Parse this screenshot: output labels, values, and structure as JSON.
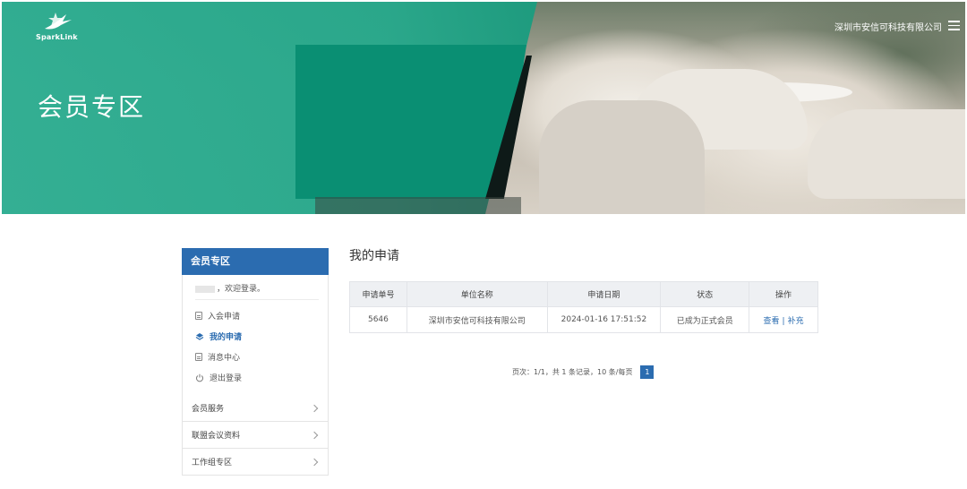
{
  "header": {
    "logo_text": "SparkLink",
    "banner_title": "会员专区",
    "company_name": "深圳市安信可科技有限公司"
  },
  "sidebar": {
    "title": "会员专区",
    "welcome": "，欢迎登录。",
    "user_menu": [
      {
        "label": "入会申请",
        "icon": "document-icon"
      },
      {
        "label": "我的申请",
        "icon": "layers-icon",
        "active": true
      },
      {
        "label": "消息中心",
        "icon": "document-icon"
      },
      {
        "label": "退出登录",
        "icon": "power-icon"
      }
    ],
    "groups": [
      {
        "label": "会员服务"
      },
      {
        "label": "联盟会议资料"
      },
      {
        "label": "工作组专区"
      }
    ]
  },
  "main": {
    "title": "我的申请",
    "table": {
      "headers": [
        "申请单号",
        "单位名称",
        "申请日期",
        "状态",
        "操作"
      ],
      "rows": [
        {
          "id": "5646",
          "org": "深圳市安信可科技有限公司",
          "date": "2024-01-16 17:51:52",
          "status": "已成为正式会员",
          "action_view": "查看",
          "action_sep": "|",
          "action_add": "补充"
        }
      ]
    },
    "pager": {
      "text": "页次：1/1，共 1 条记录，10 条/每页",
      "current_page": "1"
    }
  },
  "colors": {
    "accent": "#2b6cb0",
    "banner_green": "#28a88b"
  }
}
